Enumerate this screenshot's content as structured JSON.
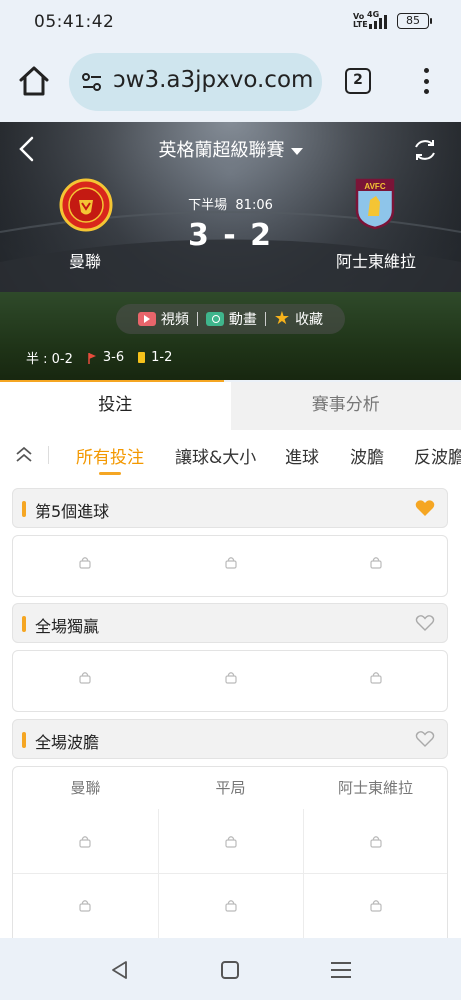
{
  "status_bar": {
    "time": "05:41:42",
    "network": "4G",
    "volte": "Vo LTE",
    "battery": "85"
  },
  "browser": {
    "url": "ɔw3.a3jpxvo.com",
    "tab_count": "2"
  },
  "match": {
    "league": "英格蘭超級聯賽",
    "period": "下半場",
    "clock": "81:06",
    "score": "3 - 2",
    "home_team": "曼聯",
    "away_team": "阿士東維拉",
    "home_logo_text": "MANCHESTER UNITED",
    "away_logo_text": "AVFC",
    "actions": {
      "video": "視頻",
      "animation": "動畫",
      "favorite": "收藏"
    },
    "stats": {
      "half_label": "半 : 0-2",
      "corners": "3-6",
      "yellow_cards": "1-2"
    }
  },
  "main_tabs": [
    {
      "label": "投注",
      "active": true
    },
    {
      "label": "賽事分析",
      "active": false
    }
  ],
  "sub_tabs": [
    {
      "label": "所有投注",
      "active": true
    },
    {
      "label": "讓球&大小",
      "active": false
    },
    {
      "label": "進球",
      "active": false
    },
    {
      "label": "波膽",
      "active": false
    },
    {
      "label": "反波膽",
      "active": false
    }
  ],
  "sections": [
    {
      "title": "第5個進球",
      "favorited": true
    },
    {
      "title": "全場獨贏",
      "favorited": false
    },
    {
      "title": "全場波膽",
      "favorited": false,
      "columns": [
        "曼聯",
        "平局",
        "阿士東維拉"
      ]
    }
  ],
  "colors": {
    "accent": "#f5a623",
    "page_bg": "#ebf1f8",
    "url_pill": "#cfe5ee"
  }
}
